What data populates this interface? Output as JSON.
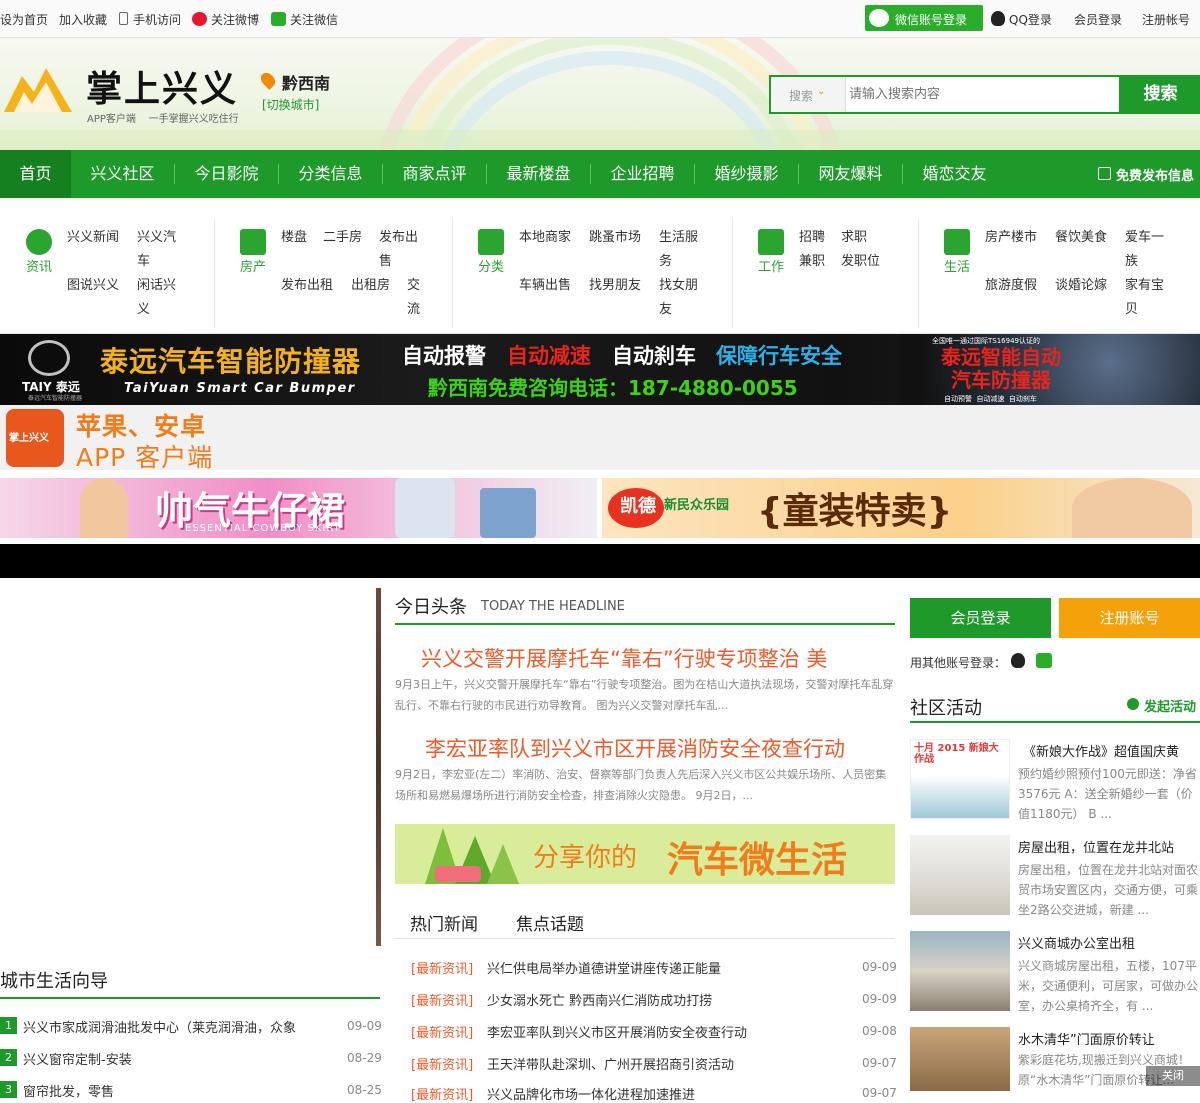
{
  "topbar": {
    "links": [
      "设为首页",
      "加入收藏",
      "手机访问",
      "关注微博",
      "关注微信"
    ],
    "wechat_login": "微信账号登录",
    "qq_login": "QQ登录",
    "member_login": "会员登录",
    "register": "注册帐号"
  },
  "header": {
    "logo_text": "掌上兴义",
    "logo_sub": "APP客户端    一手掌握兴义吃住行",
    "city": "黔西南",
    "switch_city": "[切换城市]",
    "search_type": "搜索",
    "search_placeholder": "请输入搜索内容",
    "search_button": "搜索"
  },
  "nav": {
    "items": [
      "首页",
      "兴义社区",
      "今日影院",
      "分类信息",
      "商家点评",
      "最新楼盘",
      "企业招聘",
      "婚纱摄影",
      "网友爆料",
      "婚恋交友"
    ],
    "publish": "免费发布信息"
  },
  "categories": [
    {
      "label": "资讯",
      "links": [
        "兴义新闻",
        "兴义汽车",
        "图说兴义",
        "闲话兴义"
      ]
    },
    {
      "label": "房产",
      "links": [
        "楼盘",
        "二手房",
        "发布出售",
        "发布出租",
        "出租房",
        "交流"
      ]
    },
    {
      "label": "分类",
      "links": [
        "本地商家",
        "跳蚤市场",
        "生活服务",
        "车辆出售",
        "找男朋友",
        "找女朋友"
      ]
    },
    {
      "label": "工作",
      "links": [
        "招聘",
        "求职",
        "兼职",
        "发职位"
      ]
    },
    {
      "label": "生活",
      "links": [
        "房产楼市",
        "餐饮美食",
        "爱车一族",
        "旅游度假",
        "谈婚论嫁",
        "家有宝贝"
      ]
    }
  ],
  "banners": {
    "taiy_brand": "TAIY 泰远",
    "taiy_sub": "泰远汽车智能防撞器",
    "taiy_title": "泰远汽车智能防撞器",
    "taiy_en": "TaiYuan Smart Car Bumper",
    "taiy_f1": "自动报警",
    "taiy_f2": "自动减速",
    "taiy_f3": "自动刹车",
    "taiy_f4": "保障行车安全",
    "taiy_phone": "黔西南免费咨询电话：187-4880-0055",
    "taiy_cert": "全国唯一通过国际TS16949认证的",
    "taiy_right": "泰远智能自动汽车防撞器",
    "taiy_right_sub": "自动预警  自动减速  自动刹车",
    "app_icon": "掌上兴义",
    "app_line1": "苹果、安卓",
    "app_line2": "APP 客户端",
    "skirt_title": "帅气牛仔裙",
    "skirt_en": "ESSENTIAL COWBOY SKIRT",
    "kaide_brand": "凯德",
    "kaide_sub": "新民众乐园",
    "kaide_title": "{童装特卖}"
  },
  "city_guide": {
    "title": "城市生活向导",
    "items": [
      {
        "n": "1",
        "text": "兴义市家成润滑油批发中心（莱克润滑油，众象",
        "date": "09-09"
      },
      {
        "n": "2",
        "text": "兴义窗帘定制-安装",
        "date": "08-29"
      },
      {
        "n": "3",
        "text": "窗帘批发，零售",
        "date": "08-25"
      }
    ]
  },
  "headline": {
    "title": "今日头条",
    "title_en": "TODAY THE HEADLINE",
    "stories": [
      {
        "title": "兴义交警开展摩托车“靠右”行驶专项整治 美",
        "summary": "9月3日上午，兴义交警开展摩托车“靠右”行驶专项整治。图为在桔山大道执法现场，交警对摩托车乱穿乱行、不靠右行驶的市民进行劝导教育。 图为兴义交警对摩托车乱..."
      },
      {
        "title": "李宏亚率队到兴义市区开展消防安全夜查行动",
        "summary": "9月2日，李宏亚(左二）率消防、治安、督察等部门负责人先后深入兴义市区公共娱乐场所、人员密集场所和易燃易爆场所进行消防安全检查，排查消除火灾隐患。 9月2日，..."
      }
    ],
    "ad_text1": "分享你的",
    "ad_text2": "汽车微生活"
  },
  "news_tabs": {
    "tabs": [
      "热门新闻",
      "焦点话题"
    ],
    "items": [
      {
        "tag": "[最新资讯]",
        "text": "兴仁供电局举办道德讲堂讲座传递正能量",
        "date": "09-09"
      },
      {
        "tag": "[最新资讯]",
        "text": "少女溺水死亡 黔西南兴仁消防成功打捞",
        "date": "09-09"
      },
      {
        "tag": "[最新资讯]",
        "text": "李宏亚率队到兴义市区开展消防安全夜查行动",
        "date": "09-08"
      },
      {
        "tag": "[最新资讯]",
        "text": "王天洋带队赴深圳、广州开展招商引资活动",
        "date": "09-07"
      },
      {
        "tag": "[最新资讯]",
        "text": "兴义品牌化市场一体化进程加速推进",
        "date": "09-07"
      }
    ]
  },
  "sidebar": {
    "login": "会员登录",
    "register": "注册账号",
    "other_login": "用其他账号登录：",
    "activity_title": "社区活动",
    "activity_action": "发起活动",
    "activities": [
      {
        "title": "《新娘大作战》超值国庆黄",
        "desc": "预约婚纱照预付100元即送：净省3576元 A：送全新婚纱一套（价值1180元） B ...",
        "thumb": "十月 2015 新娘大作战"
      },
      {
        "title": "房屋出租，位置在龙井北站",
        "desc": "房屋出租，位置在龙井北站对面农贸市场安置区内，交通方便，可乘坐2路公交进城，新建 ...",
        "thumb": ""
      },
      {
        "title": "兴义商城办公室出租",
        "desc": "兴义商城房屋出租，五楼，107平米，交通便利，可居家，可做办公室，办公桌椅齐全，有 ...",
        "thumb": ""
      },
      {
        "title": "水木清华”门面原价转让",
        "desc": "紫彩庭花坊,现搬迁到兴义商城！原“水木清华”门面原价转让...",
        "thumb": ""
      }
    ],
    "close": "关闭"
  },
  "colors": {
    "brand_green": "#1e9a2a",
    "accent_orange": "#f39c12",
    "headline_orange": "#f05a28",
    "tag_orange": "#f05a28"
  }
}
